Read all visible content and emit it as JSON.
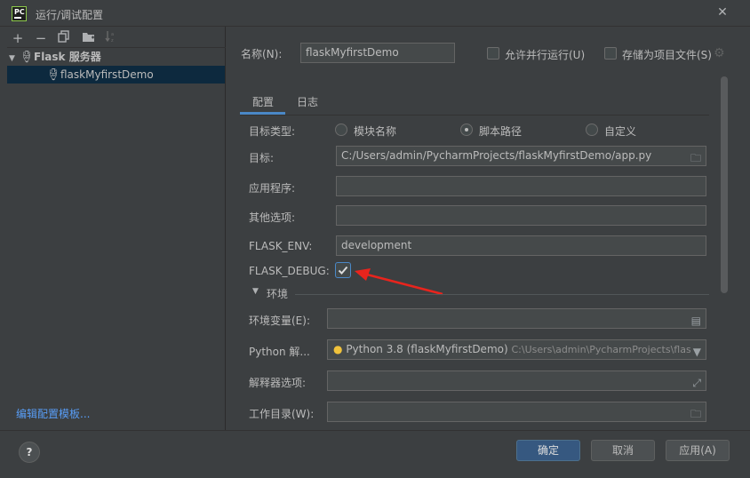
{
  "window": {
    "title": "运行/调试配置",
    "logo": "PC"
  },
  "toolbar": {
    "add": "+",
    "remove": "−",
    "copy": "copy-icon",
    "folder": "folder-add-icon",
    "sort": "sort-icon"
  },
  "tree": {
    "group_label": "Flask 服务器",
    "item_label": "flaskMyfirstDemo"
  },
  "edit_templates_link": "编辑配置模板...",
  "header": {
    "name_label": "名称(N):",
    "name_value": "flaskMyfirstDemo",
    "allow_parallel_label": "允许并行运行(U)",
    "store_as_file_label": "存储为项目文件(S)"
  },
  "tabs": [
    {
      "label": "配置"
    },
    {
      "label": "日志"
    }
  ],
  "form": {
    "target_type_label": "目标类型:",
    "radio_module": "模块名称",
    "radio_script": "脚本路径",
    "radio_custom": "自定义",
    "target_label": "目标:",
    "target_value": "C:/Users/admin/PycharmProjects/flaskMyfirstDemo/app.py",
    "app_label": "应用程序:",
    "app_value": "",
    "other_opts_label": "其他选项:",
    "other_opts_value": "",
    "flask_env_label": "FLASK_ENV:",
    "flask_env_value": "development",
    "flask_debug_label": "FLASK_DEBUG:",
    "flask_debug_checked": true,
    "env_section_label": "环境",
    "env_vars_label": "环境变量(E):",
    "python_label": "Python 解...",
    "python_value": "Python 3.8 (flaskMyfirstDemo)",
    "python_path": "C:\\Users\\admin\\PycharmProjects\\flask",
    "interp_opts_label": "解释器选项:",
    "workdir_label": "工作目录(W):"
  },
  "buttons": {
    "ok": "确定",
    "cancel": "取消",
    "apply": "应用(A)",
    "help": "?"
  },
  "colors": {
    "accent": "#4a88c7",
    "selection": "#0d293e",
    "link": "#589df6",
    "annotation_arrow": "#e8241d"
  }
}
